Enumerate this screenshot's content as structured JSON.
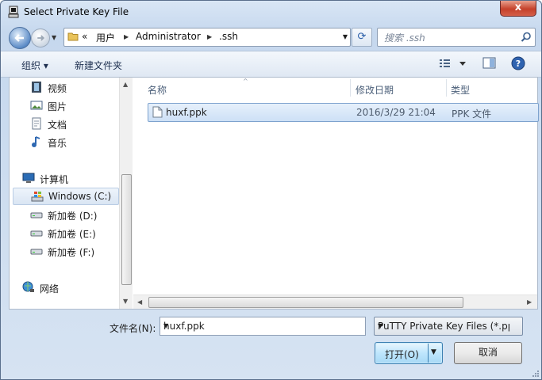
{
  "window": {
    "title": "Select Private Key File",
    "close_label": "x"
  },
  "address": {
    "prefix": "«",
    "crumbs": [
      "用户",
      "Administrator",
      ".ssh"
    ]
  },
  "search": {
    "placeholder": "搜索 .ssh"
  },
  "toolbar": {
    "organize": "组织 ▾",
    "new_folder": "新建文件夹",
    "help": "?"
  },
  "nav": {
    "items": [
      "视频",
      "图片",
      "文档",
      "音乐"
    ],
    "computer": "计算机",
    "drives": [
      "Windows (C:)",
      "新加卷 (D:)",
      "新加卷 (E:)",
      "新加卷 (F:)"
    ],
    "network": "网络"
  },
  "columns": {
    "name": "名称",
    "date": "修改日期",
    "type": "类型"
  },
  "files": [
    {
      "name": "huxf.ppk",
      "date": "2016/3/29 21:04",
      "type": "PPK 文件"
    }
  ],
  "bottom": {
    "filename_label": "文件名(N):",
    "filename_value": "huxf.ppk",
    "filetype": "PuTTY Private Key Files (*.ppk)",
    "open_label": "打开(O)",
    "cancel_label": "取消"
  }
}
